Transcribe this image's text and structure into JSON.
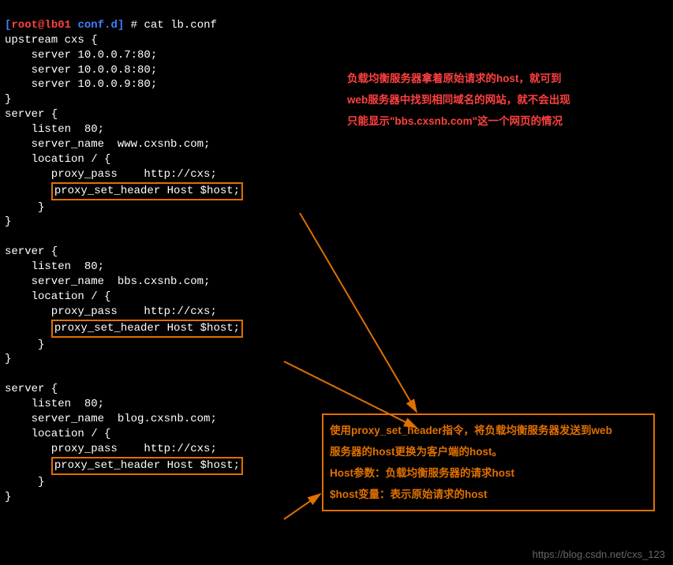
{
  "prompt": {
    "userhost": "root@lb01",
    "dir": "conf.d",
    "hash": "#"
  },
  "command": "cat lb.conf",
  "cfg": {
    "upstream_open": "upstream cxs {",
    "srv1": "    server 10.0.0.7:80;",
    "srv2": "    server 10.0.0.8:80;",
    "srv3": "    server 10.0.0.9:80;",
    "close": "}",
    "s_open": "server {",
    "listen": "    listen  80;",
    "sn_www": "    server_name  www.cxsnb.com;",
    "sn_bbs": "    server_name  bbs.cxsnb.com;",
    "sn_blog": "    server_name  blog.cxsnb.com;",
    "loc_open": "    location / {",
    "proxy_pass": "       proxy_pass    http://cxs;",
    "proxy_set": "proxy_set_header Host $host;",
    "loc_close": "     }",
    "s_close": "}"
  },
  "anno_top": {
    "l1": "负载均衡服务器拿着原始请求的host，就可到",
    "l2": "web服务器中找到相同域名的网站，就不会出现",
    "l3": "只能显示\"bbs.cxsnb.com\"这一个网页的情况"
  },
  "anno_box": {
    "l1": "使用proxy_set_header指令，将负载均衡服务器发送到web",
    "l2": "服务器的host更换为客户端的host。",
    "l3": "Host参数：负载均衡服务器的请求host",
    "l4": "$host变量：表示原始请求的host"
  },
  "watermark": "https://blog.csdn.net/cxs_123"
}
